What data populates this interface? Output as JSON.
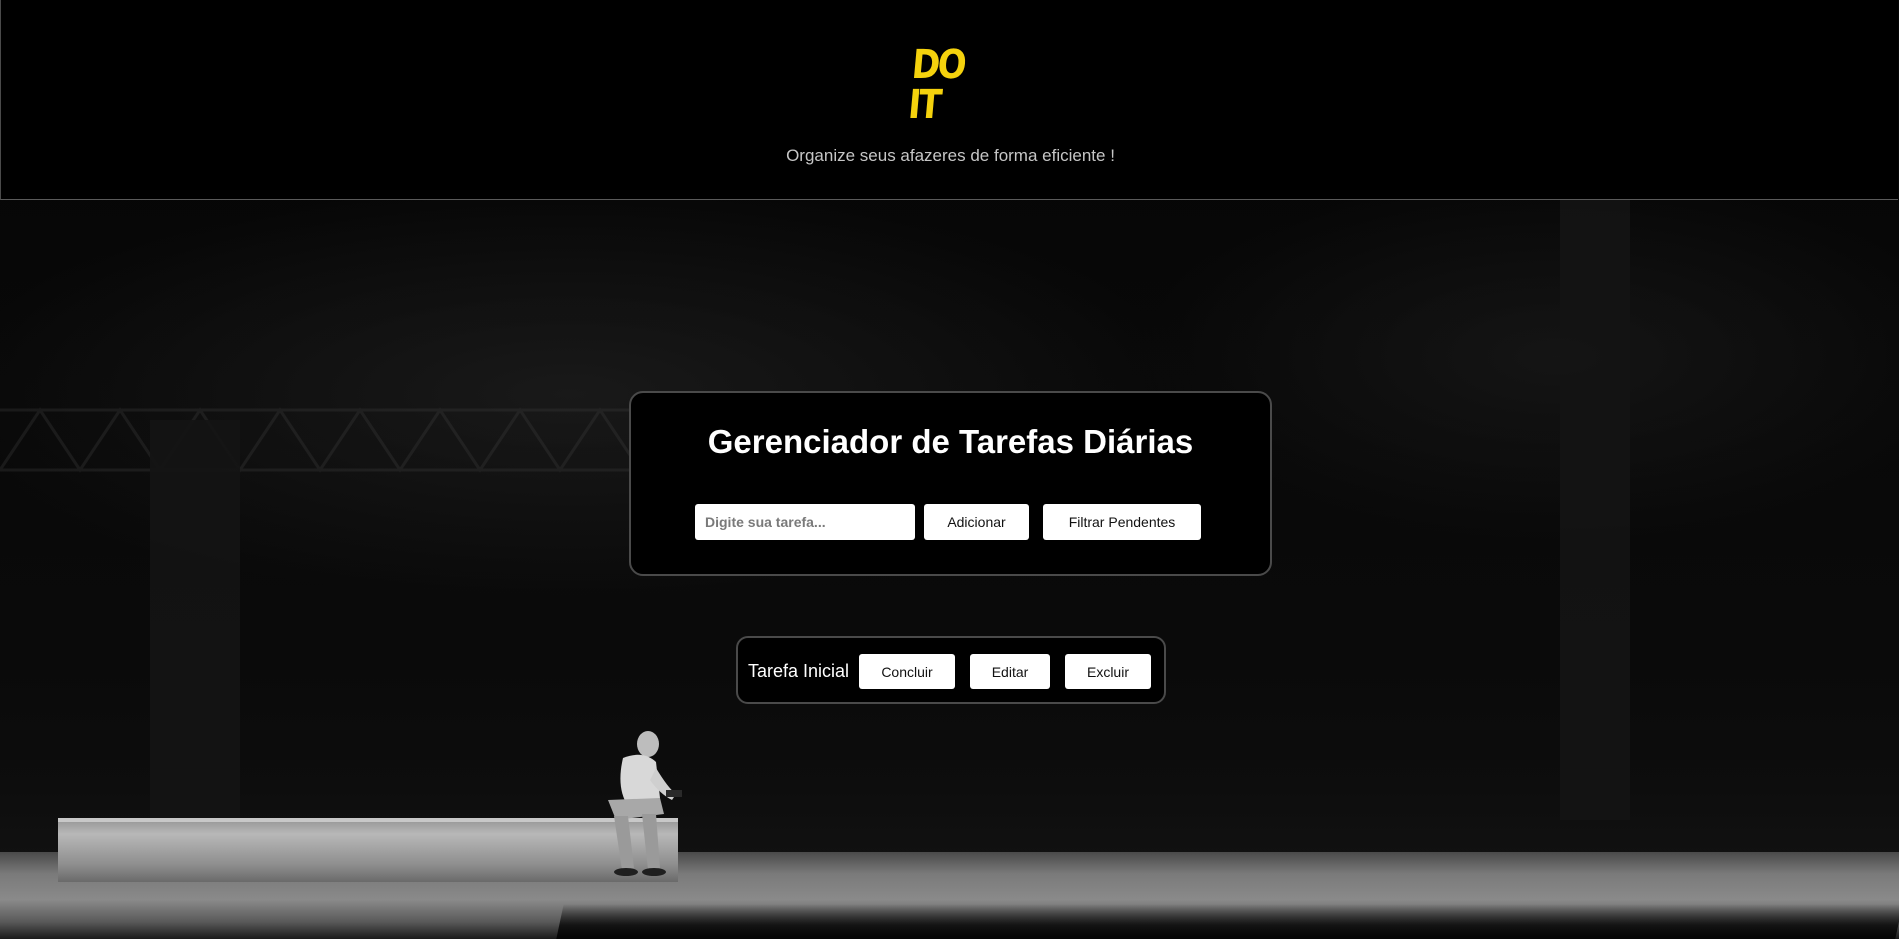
{
  "header": {
    "logo_text": "DO IT",
    "tagline": "Organize seus afazeres de forma eficiente !"
  },
  "manager": {
    "title": "Gerenciador de Tarefas Diárias",
    "input_placeholder": "Digite sua tarefa...",
    "input_value": "",
    "add_label": "Adicionar",
    "filter_label": "Filtrar Pendentes"
  },
  "tasks": [
    {
      "name": "Tarefa Inicial",
      "complete_label": "Concluir",
      "edit_label": "Editar",
      "delete_label": "Excluir"
    }
  ],
  "colors": {
    "logo": "#f5d20d",
    "background": "#000000",
    "button_bg": "#ffffff",
    "card_border": "#4a4a4a"
  }
}
